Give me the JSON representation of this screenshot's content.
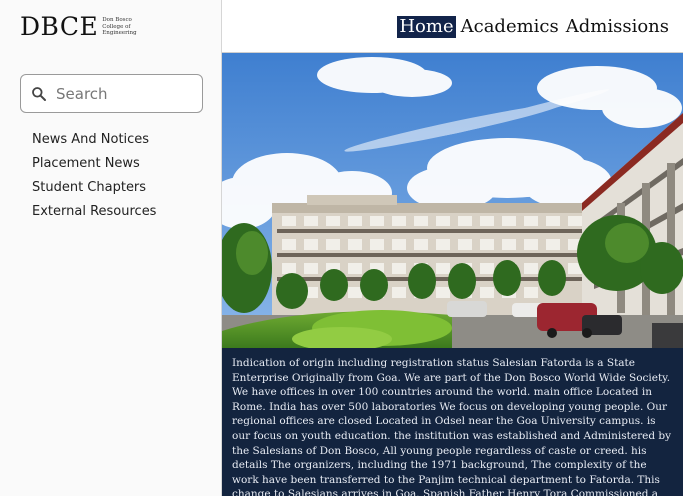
{
  "logo": {
    "mark": "DBCE",
    "sub_lines": [
      "Don Bosco",
      "College of",
      "Engineering"
    ]
  },
  "search": {
    "placeholder": "Search",
    "icon": "search-icon"
  },
  "sidebar": {
    "items": [
      {
        "label": "News And Notices"
      },
      {
        "label": "Placement News"
      },
      {
        "label": "Student Chapters"
      },
      {
        "label": "External Resources"
      }
    ]
  },
  "nav": {
    "items": [
      {
        "label": "Home",
        "active": true
      },
      {
        "label": "Academics",
        "active": false
      },
      {
        "label": "Admissions",
        "active": false
      }
    ]
  },
  "description": {
    "text": "Indication of origin including registration status Salesian Fatorda is a State Enterprise Originally from Goa. We are part of the Don Bosco World Wide Society. We have offices in over 100 countries around the world. main office Located in Rome. India has over 500 laboratories We focus on developing young people. Our regional offices are closed Located in Odsel near the Goa University campus. is our focus on youth education. the institution was established and Administered by the Salesians of Don Bosco, All young people regardless of caste or creed. his details The organizers, including the 1971 background, The complexity of the work have been transferred to the Panjim technical department to Fatorda. This change to Salesians arrives in Goa. Spanish Father Henry Tora Commissioned a construction supervision business and start the project. The"
  },
  "colors": {
    "nav_active_bg": "#12244a",
    "description_bg": "#13243f",
    "sidebar_bg": "#fafafa"
  }
}
